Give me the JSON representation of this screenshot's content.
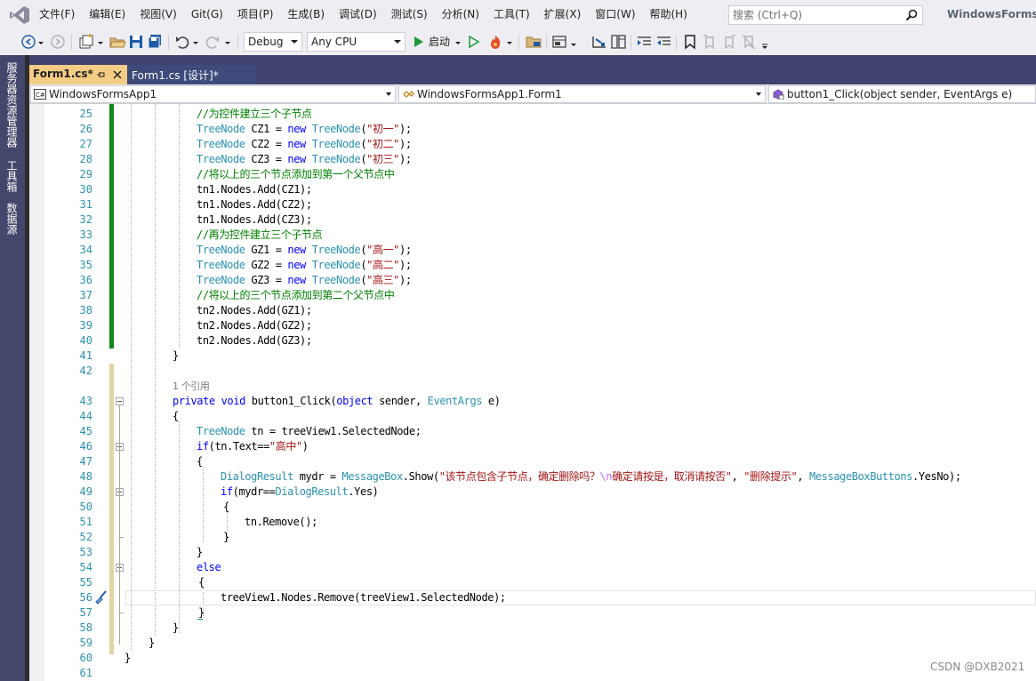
{
  "menu": {
    "items": [
      "文件(F)",
      "编辑(E)",
      "视图(V)",
      "Git(G)",
      "项目(P)",
      "生成(B)",
      "调试(D)",
      "测试(S)",
      "分析(N)",
      "工具(T)",
      "扩展(X)",
      "窗口(W)",
      "帮助(H)"
    ],
    "search_placeholder": "搜索 (Ctrl+Q)",
    "window_title": "WindowsFormsA"
  },
  "toolbar": {
    "configuration": "Debug",
    "platform": "Any CPU",
    "start_label": "启动"
  },
  "side_tabs": [
    "服务器资源管理器",
    "工具箱",
    "数据源"
  ],
  "tabs": {
    "active": "Form1.cs*",
    "inactive": "Form1.cs [设计]*"
  },
  "navbar": {
    "project": "WindowsFormsApp1",
    "class": "WindowsFormsApp1.Form1",
    "member": "button1_Click(object sender, EventArgs e)"
  },
  "editor": {
    "line_numbers": [
      "25",
      "26",
      "27",
      "28",
      "29",
      "30",
      "31",
      "32",
      "33",
      "34",
      "35",
      "36",
      "37",
      "38",
      "39",
      "40",
      "41",
      "42",
      "",
      "43",
      "44",
      "45",
      "46",
      "47",
      "48",
      "49",
      "50",
      "51",
      "52",
      "53",
      "54",
      "55",
      "56",
      "57",
      "58",
      "59",
      "60",
      "61"
    ],
    "codelens": "1 个引用",
    "lines": [
      [
        {
          "c": "cm",
          "t": "//为控件建立三个子节点"
        }
      ],
      [
        {
          "c": "ty",
          "t": "TreeNode"
        },
        {
          "c": "",
          "t": " CZ1 = "
        },
        {
          "c": "kw",
          "t": "new"
        },
        {
          "c": "",
          "t": " "
        },
        {
          "c": "ty",
          "t": "TreeNode"
        },
        {
          "c": "",
          "t": "("
        },
        {
          "c": "st",
          "t": "\"初一\""
        },
        {
          "c": "",
          "t": ");"
        }
      ],
      [
        {
          "c": "ty",
          "t": "TreeNode"
        },
        {
          "c": "",
          "t": " CZ2 = "
        },
        {
          "c": "kw",
          "t": "new"
        },
        {
          "c": "",
          "t": " "
        },
        {
          "c": "ty",
          "t": "TreeNode"
        },
        {
          "c": "",
          "t": "("
        },
        {
          "c": "st",
          "t": "\"初二\""
        },
        {
          "c": "",
          "t": ");"
        }
      ],
      [
        {
          "c": "ty",
          "t": "TreeNode"
        },
        {
          "c": "",
          "t": " CZ3 = "
        },
        {
          "c": "kw",
          "t": "new"
        },
        {
          "c": "",
          "t": " "
        },
        {
          "c": "ty",
          "t": "TreeNode"
        },
        {
          "c": "",
          "t": "("
        },
        {
          "c": "st",
          "t": "\"初三\""
        },
        {
          "c": "",
          "t": ");"
        }
      ],
      [
        {
          "c": "cm",
          "t": "//将以上的三个节点添加到第一个父节点中"
        }
      ],
      [
        {
          "c": "",
          "t": "tn1.Nodes.Add(CZ1);"
        }
      ],
      [
        {
          "c": "",
          "t": "tn1.Nodes.Add(CZ2);"
        }
      ],
      [
        {
          "c": "",
          "t": "tn1.Nodes.Add(CZ3);"
        }
      ],
      [
        {
          "c": "cm",
          "t": "//再为控件建立三个子节点"
        }
      ],
      [
        {
          "c": "ty",
          "t": "TreeNode"
        },
        {
          "c": "",
          "t": " GZ1 = "
        },
        {
          "c": "kw",
          "t": "new"
        },
        {
          "c": "",
          "t": " "
        },
        {
          "c": "ty",
          "t": "TreeNode"
        },
        {
          "c": "",
          "t": "("
        },
        {
          "c": "st",
          "t": "\"高一\""
        },
        {
          "c": "",
          "t": ");"
        }
      ],
      [
        {
          "c": "ty",
          "t": "TreeNode"
        },
        {
          "c": "",
          "t": " GZ2 = "
        },
        {
          "c": "kw",
          "t": "new"
        },
        {
          "c": "",
          "t": " "
        },
        {
          "c": "ty",
          "t": "TreeNode"
        },
        {
          "c": "",
          "t": "("
        },
        {
          "c": "st",
          "t": "\"高二\""
        },
        {
          "c": "",
          "t": ");"
        }
      ],
      [
        {
          "c": "ty",
          "t": "TreeNode"
        },
        {
          "c": "",
          "t": " GZ3 = "
        },
        {
          "c": "kw",
          "t": "new"
        },
        {
          "c": "",
          "t": " "
        },
        {
          "c": "ty",
          "t": "TreeNode"
        },
        {
          "c": "",
          "t": "("
        },
        {
          "c": "st",
          "t": "\"高三\""
        },
        {
          "c": "",
          "t": ");"
        }
      ],
      [
        {
          "c": "cm",
          "t": "//将以上的三个节点添加到第二个父节点中"
        }
      ],
      [
        {
          "c": "",
          "t": "tn2.Nodes.Add(GZ1);"
        }
      ],
      [
        {
          "c": "",
          "t": "tn2.Nodes.Add(GZ2);"
        }
      ],
      [
        {
          "c": "",
          "t": "tn2.Nodes.Add(GZ3);"
        }
      ],
      [
        {
          "c": "",
          "t": "}"
        }
      ],
      [],
      [],
      [
        {
          "c": "kw",
          "t": "private"
        },
        {
          "c": "",
          "t": " "
        },
        {
          "c": "kw",
          "t": "void"
        },
        {
          "c": "",
          "t": " button1_Click("
        },
        {
          "c": "kw",
          "t": "object"
        },
        {
          "c": "",
          "t": " sender, "
        },
        {
          "c": "ty",
          "t": "EventArgs"
        },
        {
          "c": "",
          "t": " e)"
        }
      ],
      [
        {
          "c": "",
          "t": "{"
        }
      ],
      [
        {
          "c": "ty",
          "t": "TreeNode"
        },
        {
          "c": "",
          "t": " tn = treeView1.SelectedNode;"
        }
      ],
      [
        {
          "c": "kw",
          "t": "if"
        },
        {
          "c": "",
          "t": "(tn.Text=="
        },
        {
          "c": "st",
          "t": "\"高中\""
        },
        {
          "c": "",
          "t": ")"
        }
      ],
      [
        {
          "c": "",
          "t": "{"
        }
      ],
      [
        {
          "c": "ty",
          "t": "DialogResult"
        },
        {
          "c": "",
          "t": " mydr = "
        },
        {
          "c": "ty",
          "t": "MessageBox"
        },
        {
          "c": "",
          "t": ".Show("
        },
        {
          "c": "st",
          "t": "\"该节点包含子节点，确定删除吗？"
        },
        {
          "c": "esc",
          "t": "\\n"
        },
        {
          "c": "st",
          "t": "确定请按是，取消请按否\""
        },
        {
          "c": "",
          "t": ", "
        },
        {
          "c": "st",
          "t": "\"删除提示\""
        },
        {
          "c": "",
          "t": ", "
        },
        {
          "c": "ty",
          "t": "MessageBoxButtons"
        },
        {
          "c": "",
          "t": ".YesNo);"
        }
      ],
      [
        {
          "c": "kw",
          "t": "if"
        },
        {
          "c": "",
          "t": "(mydr=="
        },
        {
          "c": "ty",
          "t": "DialogResult"
        },
        {
          "c": "",
          "t": ".Yes)"
        }
      ],
      [
        {
          "c": "",
          "t": "{"
        }
      ],
      [
        {
          "c": "",
          "t": "tn.Remove();"
        }
      ],
      [
        {
          "c": "",
          "t": "}"
        }
      ],
      [
        {
          "c": "",
          "t": "}"
        }
      ],
      [
        {
          "c": "kw",
          "t": "else"
        }
      ],
      [
        {
          "c": "",
          "t": "{"
        }
      ],
      [
        {
          "c": "",
          "t": "treeView1.Nodes.Remove(treeView1.SelectedNode);"
        }
      ],
      [
        {
          "c": "",
          "t": "}"
        }
      ],
      [
        {
          "c": "",
          "t": "}"
        }
      ],
      [
        {
          "c": "",
          "t": "}"
        }
      ],
      [
        {
          "c": "",
          "t": "}"
        }
      ],
      []
    ]
  },
  "watermark": "CSDN @DXB2021"
}
